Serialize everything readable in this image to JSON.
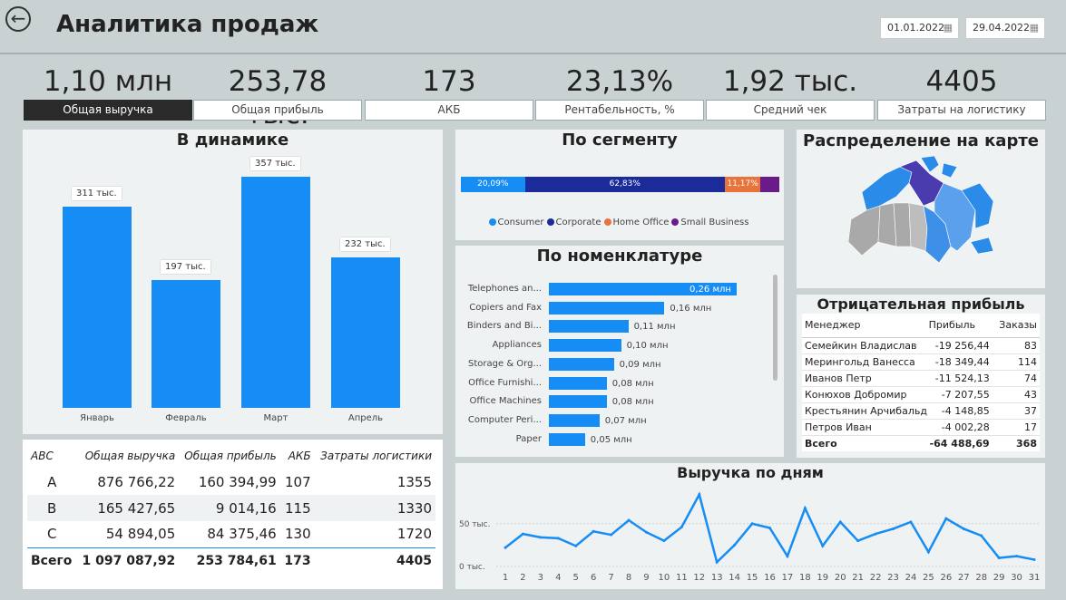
{
  "header": {
    "back_icon": "back-arrow-icon",
    "title": "Аналитика продаж",
    "date_from": "01.01.2022",
    "date_to": "29.04.2022",
    "calendar_icon": "calendar-icon"
  },
  "kpis": [
    {
      "value": "1,10 млн",
      "label": "Общая выручка"
    },
    {
      "value": "253,78 тыс.",
      "label": "Общая прибыль"
    },
    {
      "value": "173",
      "label": "АКБ"
    },
    {
      "value": "23,13%",
      "label": "Рентабельность, %"
    },
    {
      "value": "1,92 тыс.",
      "label": "Средний чек"
    },
    {
      "value": "4405",
      "label": "Затраты на логистику"
    }
  ],
  "dynamics": {
    "title": "В динамике",
    "chart_data": {
      "type": "bar",
      "categories": [
        "Январь",
        "Февраль",
        "Март",
        "Апрель"
      ],
      "values": [
        311,
        197,
        357,
        232
      ],
      "data_labels": [
        "311 тыс.",
        "197 тыс.",
        "357 тыс.",
        "232 тыс."
      ],
      "ylim": [
        0,
        400
      ],
      "color": "#168cf5"
    }
  },
  "segment": {
    "title": "По сегменту",
    "chart_data": {
      "type": "bar",
      "stacked_100": true,
      "series": [
        {
          "name": "Consumer",
          "value": 20.09,
          "label": "20,09%",
          "color": "#168cf5"
        },
        {
          "name": "Corporate",
          "value": 62.83,
          "label": "62,83%",
          "color": "#1b2c9a"
        },
        {
          "name": "Home Office",
          "value": 11.17,
          "label": "11,17%",
          "color": "#e8743b"
        },
        {
          "name": "Small Business",
          "value": 5.91,
          "label": "",
          "color": "#6a1b8a"
        }
      ]
    }
  },
  "nomenclature": {
    "title": "По номенклатуре",
    "chart_data": {
      "type": "bar",
      "orientation": "horizontal",
      "categories": [
        "Telephones an...",
        "Copiers and Fax",
        "Binders and Bi...",
        "Appliances",
        "Storage & Org...",
        "Office Furnishi...",
        "Office Machines",
        "Computer Peri...",
        "Paper"
      ],
      "values": [
        0.26,
        0.16,
        0.11,
        0.1,
        0.09,
        0.08,
        0.08,
        0.07,
        0.05
      ],
      "data_labels": [
        "0,26 млн",
        "0,16 млн",
        "0,11 млн",
        "0,10 млн",
        "0,09 млн",
        "0,08 млн",
        "0,08 млн",
        "0,07 млн",
        "0,05 млн"
      ],
      "xlim": [
        0,
        0.26
      ]
    }
  },
  "map": {
    "title": "Распределение на карте"
  },
  "negative": {
    "title": "Отрицательная прибыль",
    "columns": [
      "Менеджер",
      "Прибыль",
      "Заказы"
    ],
    "rows": [
      [
        "Семейкин Владислав",
        "-19 256,44",
        "83"
      ],
      [
        "Мерингольд Ванесса",
        "-18 349,44",
        "114"
      ],
      [
        "Иванов Петр",
        "-11 524,13",
        "74"
      ],
      [
        "Конюхов Добромир",
        "-7 207,55",
        "43"
      ],
      [
        "Крестьянин Арчибальд",
        "-4 148,85",
        "37"
      ],
      [
        "Петров Иван",
        "-4 002,28",
        "17"
      ]
    ],
    "total": [
      "Всего",
      "-64 488,69",
      "368"
    ]
  },
  "abc": {
    "columns": [
      "ABC",
      "Общая выручка",
      "Общая прибыль",
      "АКБ",
      "Затраты логистики"
    ],
    "rows": [
      [
        "A",
        "876 766,22",
        "160 394,99",
        "107",
        "1355"
      ],
      [
        "B",
        "165 427,65",
        "9 014,16",
        "115",
        "1330"
      ],
      [
        "C",
        "54 894,05",
        "84 375,46",
        "130",
        "1720"
      ]
    ],
    "total": [
      "Всего",
      "1 097 087,92",
      "253 784,61",
      "173",
      "4405"
    ]
  },
  "daily": {
    "title": "Выручка по дням",
    "chart_data": {
      "type": "line",
      "x": [
        1,
        2,
        3,
        4,
        5,
        6,
        7,
        8,
        9,
        10,
        11,
        12,
        13,
        14,
        15,
        16,
        17,
        18,
        19,
        20,
        21,
        22,
        23,
        24,
        25,
        26,
        27,
        28,
        29,
        30,
        31
      ],
      "y": [
        22,
        38,
        34,
        33,
        24,
        41,
        37,
        54,
        40,
        30,
        46,
        84,
        5,
        25,
        50,
        45,
        12,
        68,
        24,
        52,
        30,
        38,
        44,
        52,
        17,
        56,
        44,
        36,
        10,
        12,
        8
      ],
      "yticks": [
        "0 тыс.",
        "50 тыс."
      ],
      "ylim": [
        0,
        90
      ],
      "color": "#168cf5"
    }
  }
}
